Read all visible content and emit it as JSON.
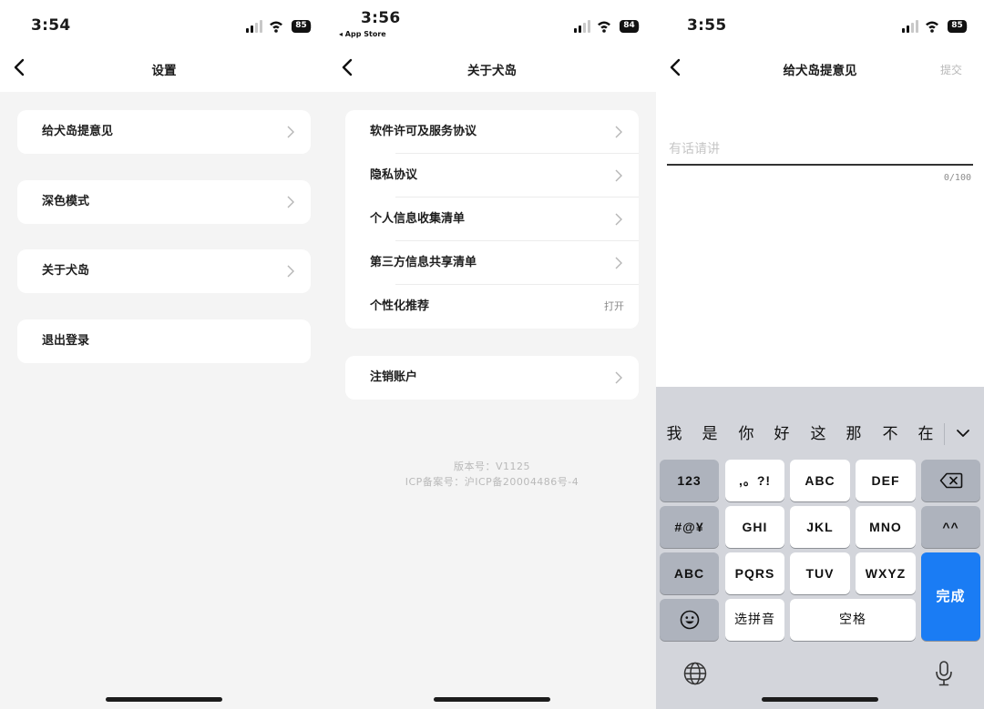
{
  "settings_screen": {
    "status_time": "3:54",
    "battery": "85",
    "title": "设置",
    "items": [
      {
        "label": "给犬岛提意见"
      },
      {
        "label": "深色模式"
      },
      {
        "label": "关于犬岛"
      },
      {
        "label": "退出登录"
      }
    ]
  },
  "about_screen": {
    "status_time": "3:56",
    "back_app": "◂ App Store",
    "battery": "84",
    "title": "关于犬岛",
    "items": [
      {
        "label": "软件许可及服务协议"
      },
      {
        "label": "隐私协议"
      },
      {
        "label": "个人信息收集清单"
      },
      {
        "label": "第三方信息共享清单"
      },
      {
        "label": "个性化推荐",
        "value": "打开"
      }
    ],
    "cancel_account": "注销账户",
    "version": "版本号：V1125",
    "icp": "ICP备案号：沪ICP备20004486号-4"
  },
  "feedback_screen": {
    "status_time": "3:55",
    "battery": "85",
    "title": "给犬岛提意见",
    "submit": "提交",
    "placeholder": "有话请讲",
    "count": "0/100",
    "keyboard": {
      "candidates": [
        "我",
        "是",
        "你",
        "好",
        "这",
        "那",
        "不",
        "在"
      ],
      "row1": [
        "123",
        ",。?!",
        "ABC",
        "DEF"
      ],
      "row2": [
        "#@¥",
        "GHI",
        "JKL",
        "MNO",
        "^^"
      ],
      "row3": [
        "ABC",
        "PQRS",
        "TUV",
        "WXYZ"
      ],
      "row4": [
        "选拼音",
        "空格"
      ],
      "done": "完成"
    }
  },
  "icons": [
    "chevron-left-icon",
    "chevron-right-icon",
    "signal-icon",
    "wifi-icon",
    "battery-icon",
    "backspace-icon",
    "emoji-icon",
    "globe-icon",
    "microphone-icon",
    "chevron-down-icon"
  ]
}
